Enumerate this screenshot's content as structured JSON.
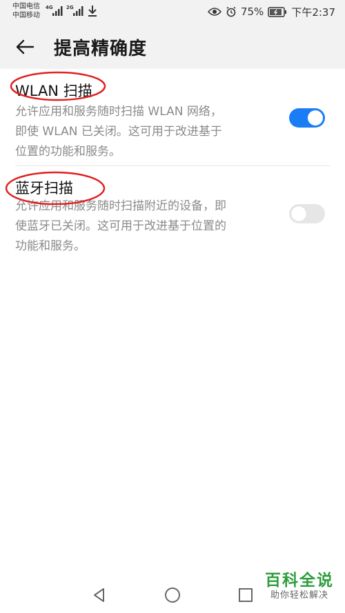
{
  "status_bar": {
    "carrier_1": "中国电信",
    "carrier_2": "中国移动",
    "net_1": "4G",
    "net_2": "2G",
    "battery": "75%",
    "time": "下午2:37"
  },
  "app_bar": {
    "title": "提高精确度"
  },
  "settings": [
    {
      "title": "WLAN 扫描",
      "description_lines": [
        "允许应用和服务随时扫描 WLAN 网络，",
        "即使 WLAN 已关闭。这可用于改进基于",
        "位置的功能和服务。"
      ],
      "enabled": true
    },
    {
      "title": "蓝牙扫描",
      "description_lines": [
        "允许应用和服务随时扫描附近的设备，即",
        "使蓝牙已关闭。这可用于改进基于位置的",
        "功能和服务。"
      ],
      "enabled": false
    }
  ],
  "colors": {
    "toggle_on": "#1a7df5",
    "toggle_off": "#e6e6e6",
    "annotation_red": "#e02020",
    "watermark_green": "#2e9d3c"
  },
  "watermark": {
    "main": "百科全说",
    "sub": "助你轻松解决"
  }
}
